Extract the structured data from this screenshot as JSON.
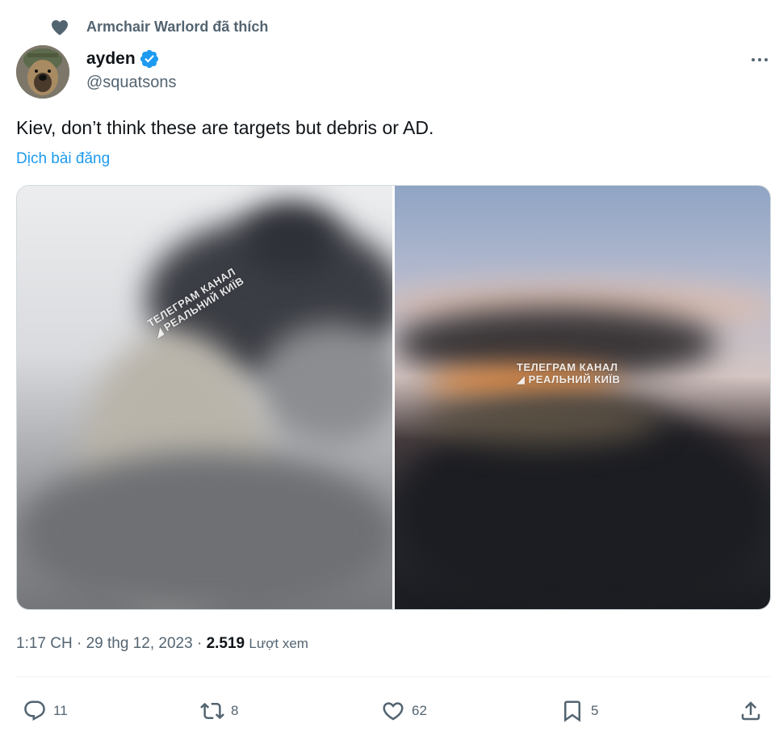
{
  "social_context": {
    "text": "Armchair Warlord đã thích",
    "icon": "heart-icon"
  },
  "author": {
    "name": "ayden",
    "handle": "@squatsons",
    "verified": true,
    "verified_color": "#1d9bf0"
  },
  "tweet": {
    "text": "Kiev, don’t think these are targets but debris or AD.",
    "translate_label": "Dịch bài đăng"
  },
  "media": {
    "photo_1": {
      "watermark_line1": "ТЕЛЕГРАМ КАНАЛ",
      "watermark_line2": "◢ РЕАЛЬНИЙ КИЇВ"
    },
    "photo_2": {
      "watermark_line1": "ТЕЛЕГРАМ КАНАЛ",
      "watermark_line2": "◢ РЕАЛЬНИЙ КИЇВ"
    }
  },
  "meta": {
    "time": "1:17 CH",
    "separator": "·",
    "date": "29 thg 12, 2023",
    "views_count": "2.519",
    "views_label": "Lượt xem"
  },
  "actions": {
    "reply_count": "11",
    "retweet_count": "8",
    "like_count": "62",
    "bookmark_count": "5"
  },
  "colors": {
    "text_primary": "#0f1419",
    "text_secondary": "#536471",
    "accent": "#1d9bf0",
    "divider": "#eff3f4"
  }
}
